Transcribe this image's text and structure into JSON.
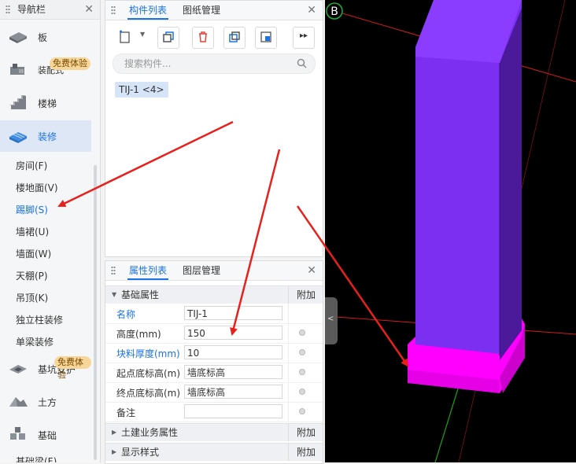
{
  "nav": {
    "title": "导航栏",
    "categories": [
      {
        "label": "板",
        "icon": "slab-icon"
      },
      {
        "label": "装配式",
        "icon": "prefab-icon",
        "badge": "免费体验"
      },
      {
        "label": "楼梯",
        "icon": "stairs-icon"
      },
      {
        "label": "装修",
        "icon": "decoration-icon"
      }
    ],
    "subitems": [
      "房间(F)",
      "楼地面(V)",
      "踢脚(S)",
      "墙裙(U)",
      "墙面(W)",
      "天棚(P)",
      "吊顶(K)",
      "独立柱装修",
      "单梁装修"
    ],
    "bottom_categories": [
      {
        "label": "基坑支护",
        "icon": "pit-support-icon",
        "badge": "免费体验"
      },
      {
        "label": "土方",
        "icon": "earthwork-icon"
      },
      {
        "label": "基础",
        "icon": "foundation-icon"
      }
    ],
    "cut_item": "基础梁(F)"
  },
  "component_pane": {
    "tabs": [
      "构件列表",
      "图纸管理"
    ],
    "search_placeholder": "搜索构件...",
    "items": [
      "TIJ-1 <4>"
    ]
  },
  "properties_pane": {
    "tabs": [
      "属性列表",
      "图层管理"
    ],
    "group_basic": "基础属性",
    "addon_label": "附加",
    "rows": [
      {
        "key": "名称",
        "value": "TIJ-1",
        "blue": true,
        "dot": false
      },
      {
        "key": "高度(mm)",
        "value": "150",
        "blue": false,
        "dot": true
      },
      {
        "key": "块料厚度(mm)",
        "value": "10",
        "blue": true,
        "dot": true
      },
      {
        "key": "起点底标高(m)",
        "value": "墙底标高",
        "blue": false,
        "dot": true
      },
      {
        "key": "终点底标高(m)",
        "value": "墙底标高",
        "blue": false,
        "dot": true
      },
      {
        "key": "备注",
        "value": "",
        "blue": false,
        "dot": true
      }
    ],
    "group_civil": "土建业务属性",
    "group_display": "显示样式"
  },
  "viewport": {
    "axis_label": "B",
    "column_front": "#7b2ff0",
    "column_side": "#4b1a9a",
    "column_top": "#9a50ff",
    "footing_color": "#ff00ff",
    "footing_side": "#cc00cc"
  }
}
